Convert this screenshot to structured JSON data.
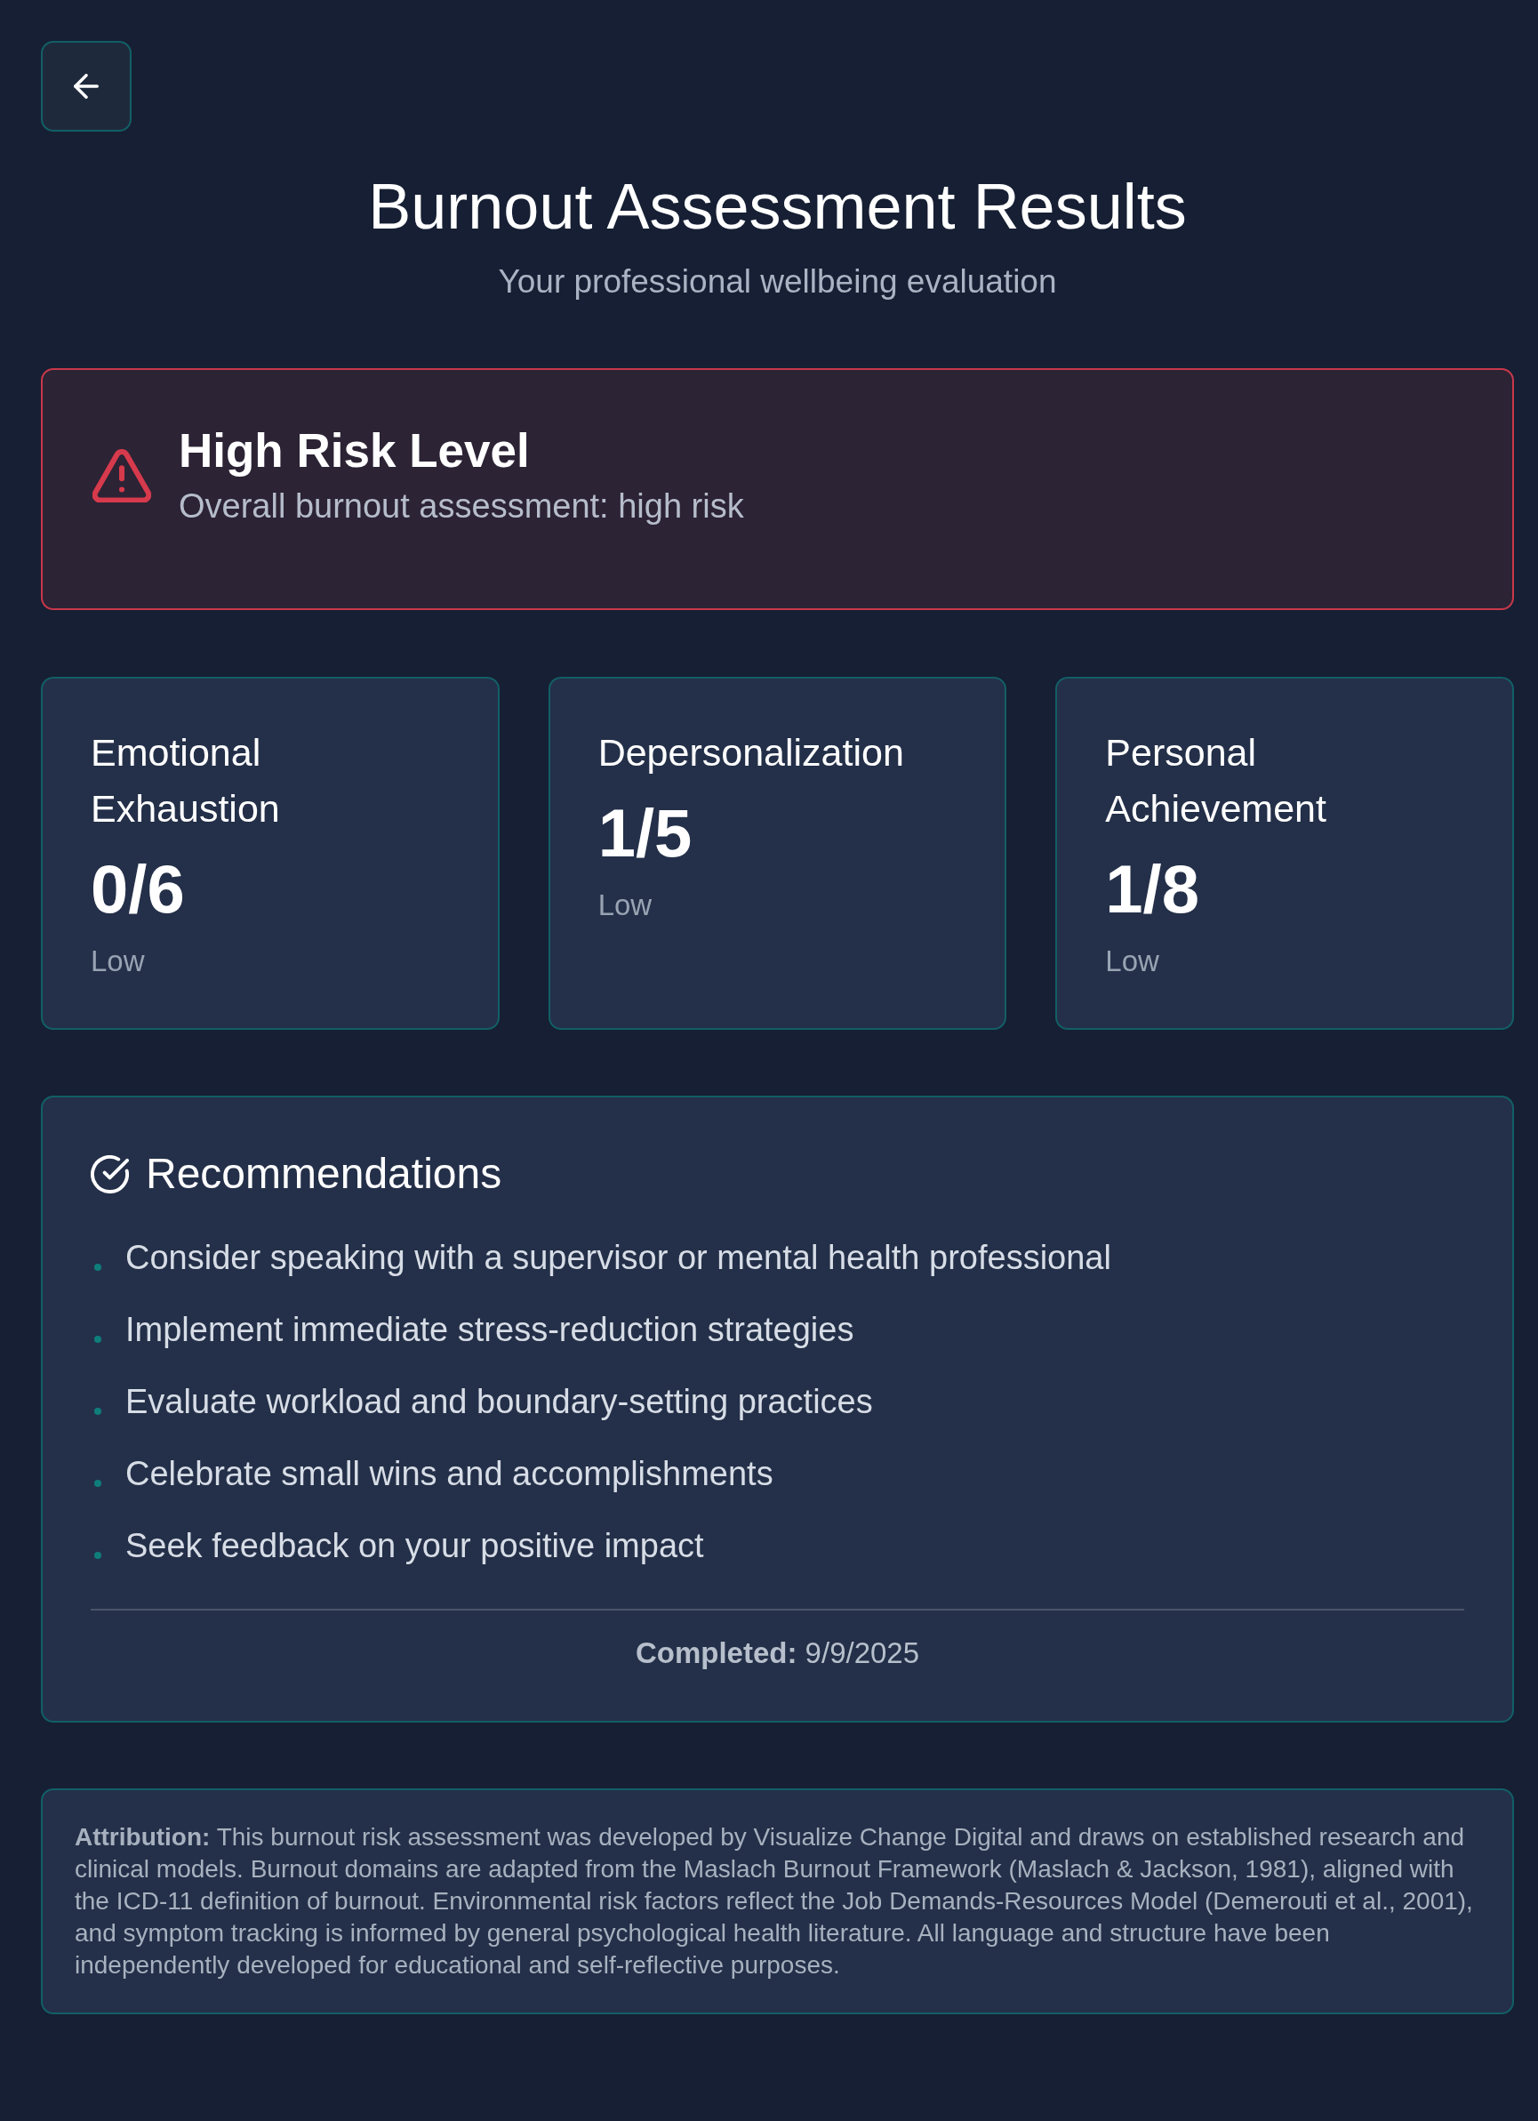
{
  "header": {
    "title": "Burnout Assessment Results",
    "subtitle": "Your professional wellbeing evaluation"
  },
  "risk": {
    "kind": "danger",
    "title": "High Risk Level",
    "summary": "Overall burnout assessment: high risk"
  },
  "scores": [
    {
      "label": "Emotional Exhaustion",
      "value": "0/6",
      "rating": "Low"
    },
    {
      "label": "Depersonalization",
      "value": "1/5",
      "rating": "Low"
    },
    {
      "label": "Personal Achievement",
      "value": "1/8",
      "rating": "Low"
    }
  ],
  "recommendations": {
    "title": "Recommendations",
    "items": [
      "Consider speaking with a supervisor or mental health professional",
      "Implement immediate stress-reduction strategies",
      "Evaluate workload and boundary-setting practices",
      "Celebrate small wins and accomplishments",
      "Seek feedback on your positive impact"
    ],
    "completed": "**Completed:** 9/9/2025"
  },
  "attribution": {
    "text": "**Attribution:** This burnout risk assessment was developed by Visualize Change Digital and draws on established research and clinical models. Burnout domains are adapted from the Maslach Burnout Framework (Maslach & Jackson, 1981), aligned with the ICD-11 definition of burnout. Environmental risk factors reflect the Job Demands-Resources Model (Demerouti et al., 2001), and symptom tracking is informed by general psychological health literature. All language and structure have been independently developed for educational and self-reflective purposes."
  }
}
